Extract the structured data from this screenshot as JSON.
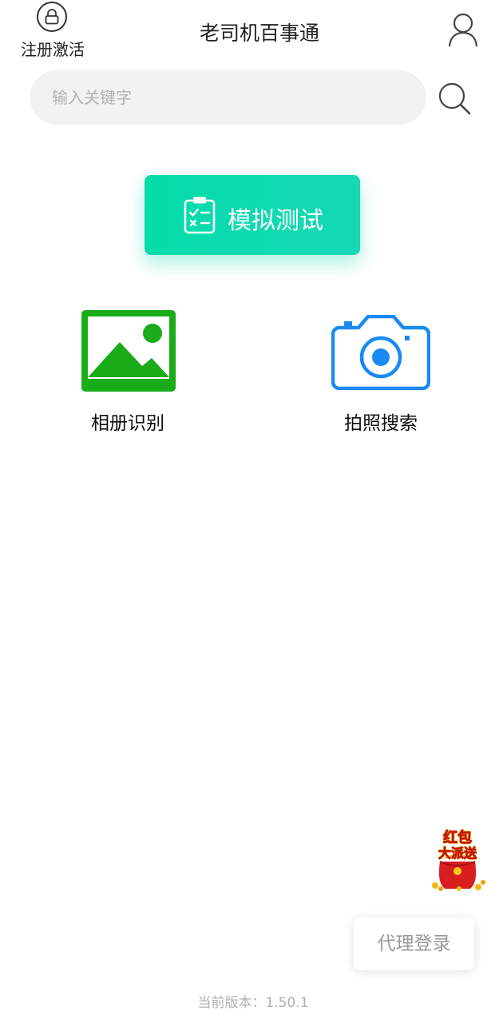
{
  "header": {
    "register_label": "注册激活",
    "register_icon": "lock-icon",
    "title": "老司机百事通",
    "user_icon": "user-icon"
  },
  "search": {
    "placeholder": "输入关键字",
    "value": "",
    "icon": "search-icon"
  },
  "mock_test": {
    "label": "模拟测试",
    "icon": "clipboard-checklist-icon",
    "gradient_start": "#05dcaa",
    "gradient_end": "#16d8b5"
  },
  "features": [
    {
      "label": "相册识别",
      "icon": "image-icon",
      "color": "#1aac19"
    },
    {
      "label": "拍照搜索",
      "icon": "camera-icon",
      "color": "#1a8af0"
    }
  ],
  "promo": {
    "line1": "红包",
    "line2": "大派送",
    "icon": "red-envelope-icon"
  },
  "agent_login": {
    "label": "代理登录"
  },
  "footer": {
    "version_label": "当前版本：",
    "version_number": "1.50.1"
  }
}
